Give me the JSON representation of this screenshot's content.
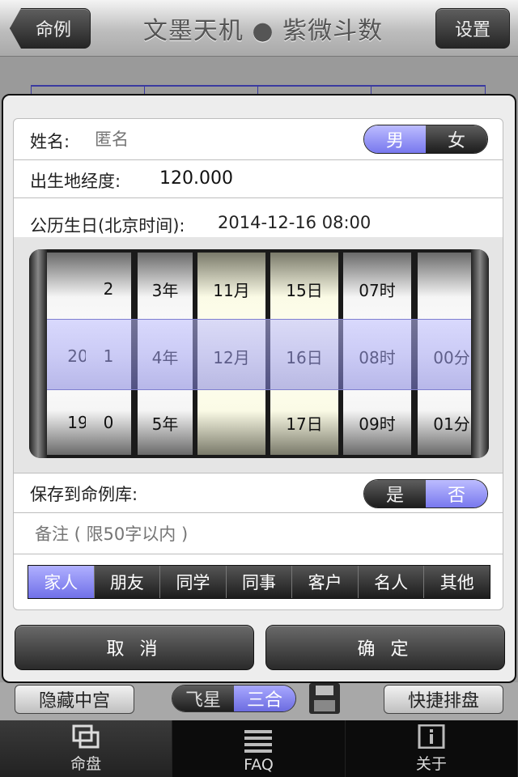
{
  "navbar": {
    "back_label": "命例",
    "title": "文墨天机 ● 紫微斗数",
    "settings_label": "设置"
  },
  "dialog": {
    "name_label": "姓名:",
    "name_placeholder": "匿名",
    "gender": {
      "male": "男",
      "female": "女",
      "selected": "男"
    },
    "longitude_label": "出生地经度:",
    "longitude_value": "120.000",
    "birthday_label": "公历生日(北京时间):",
    "birthday_value": "2014-12-16 08:00",
    "picker": {
      "columns": [
        {
          "rows": [
            "",
            "20",
            "19"
          ]
        },
        {
          "rows": [
            "2",
            "1",
            "0"
          ]
        },
        {
          "rows": [
            "3年",
            "4年",
            "5年"
          ]
        },
        {
          "rows": [
            "11月",
            "12月",
            ""
          ]
        },
        {
          "rows": [
            "15日",
            "16日",
            "17日"
          ]
        },
        {
          "rows": [
            "07时",
            "08时",
            "09时"
          ]
        },
        {
          "rows": [
            "",
            "00分",
            "01分"
          ]
        }
      ]
    },
    "save_label": "保存到命例库:",
    "save_toggle": {
      "yes": "是",
      "no": "否",
      "selected": "否"
    },
    "note_placeholder": "备注 ( 限50字以内 )",
    "tags": [
      "家人",
      "朋友",
      "同学",
      "同事",
      "客户",
      "名人",
      "其他"
    ],
    "selected_tag": "家人",
    "cancel_label": "取 消",
    "confirm_label": "确 定"
  },
  "toolbar": {
    "hide_center_label": "隐藏中宫",
    "flying_star": "飞星",
    "san_he": "三合",
    "quick_chart_label": "快捷排盘",
    "save_icon": "floppy-disk-icon"
  },
  "tabs": [
    {
      "label": "命盘",
      "icon": "chart-icon",
      "active": true
    },
    {
      "label": "FAQ",
      "icon": "list-icon",
      "active": false
    },
    {
      "label": "关于",
      "icon": "info-icon",
      "active": false
    }
  ]
}
